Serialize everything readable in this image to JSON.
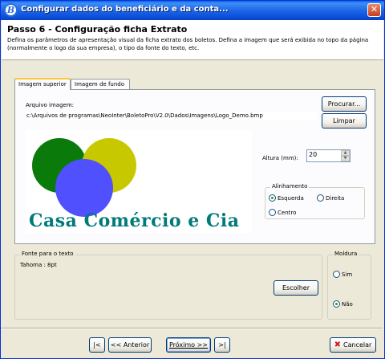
{
  "window": {
    "title": "Configurar dados do beneficiário e da conta...",
    "icon": "boletopro-app-icon",
    "close_symbol": "✕"
  },
  "header": {
    "step_title": "Passo 6 - Configuração ficha Extrato",
    "description": "Defina os parâmetros de apresentação visual da ficha extrato dos boletos. Defina a imagem que será exibida no topo da página (normalmente o logo da sua empresa), o tipo da fonte do texto, etc."
  },
  "tabs": [
    {
      "label": "Imagem superior",
      "active": true
    },
    {
      "label": "Imagem de fundo",
      "active": false
    }
  ],
  "image_panel": {
    "file_label": "Arquivo imagem:",
    "file_path": "c:\\Arquivos de programas\\NeoInter\\BoletoPro\\V2.0\\Dados\\Imagens\\Logo_Demo.bmp",
    "browse_button": "Procurar...",
    "clear_button": "Limpar",
    "logo_text": "Casa Comércio e Cia",
    "logo_colors": {
      "green": "#0A7A0A",
      "yellow": "#C8C800",
      "blue": "#5050FF",
      "text": "#007A7A"
    },
    "height_label": "Altura (mm):",
    "height_value": "20",
    "alignment": {
      "title": "Alinhamento",
      "options": [
        {
          "label": "Esquerda",
          "selected": true
        },
        {
          "label": "Direita",
          "selected": false
        },
        {
          "label": "Centro",
          "selected": false
        }
      ]
    }
  },
  "font_panel": {
    "title": "Fonte para o texto",
    "value": "Tahoma : 8pt",
    "choose_button": "Escolher"
  },
  "frame_panel": {
    "title": "Moldura",
    "options": [
      {
        "label": "Sim",
        "selected": false
      },
      {
        "label": "Não",
        "selected": true
      }
    ]
  },
  "navigation": {
    "first": "|<",
    "previous": "<< Anterior",
    "next": "Próximo >>",
    "last": ">|",
    "cancel": "Cancelar"
  }
}
